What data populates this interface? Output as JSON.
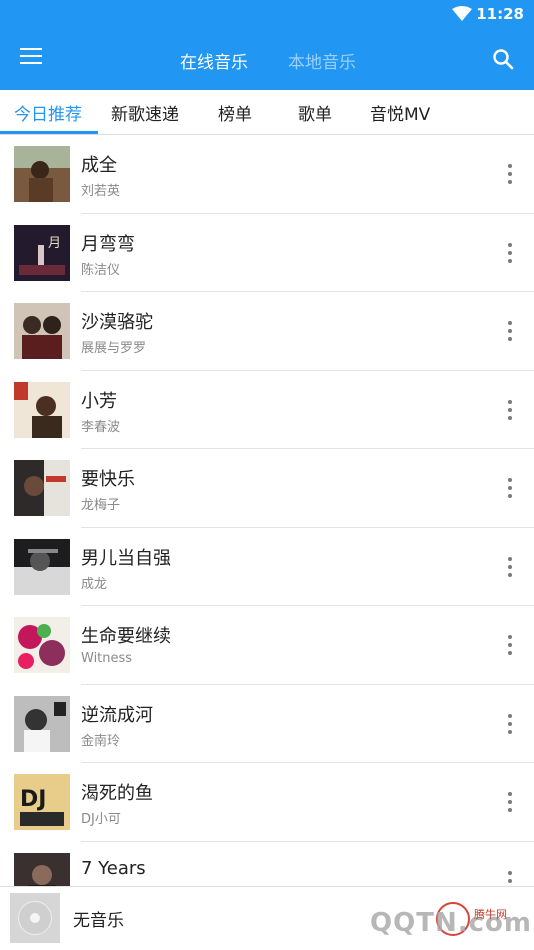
{
  "status_bar": {
    "time": "11:28"
  },
  "app_bar": {
    "tabs": [
      {
        "label": "在线音乐",
        "active": true
      },
      {
        "label": "本地音乐",
        "active": false
      }
    ]
  },
  "sub_tabs": [
    {
      "label": "今日推荐",
      "active": true
    },
    {
      "label": "新歌速递",
      "active": false
    },
    {
      "label": "榜单",
      "active": false
    },
    {
      "label": "歌单",
      "active": false
    },
    {
      "label": "音悦MV",
      "active": false
    }
  ],
  "songs": [
    {
      "title": "成全",
      "artist": "刘若英",
      "cover_color": "#7a5a3e"
    },
    {
      "title": "月弯弯",
      "artist": "陈洁仪",
      "cover_color": "#231a2e"
    },
    {
      "title": "沙漠骆驼",
      "artist": "展展与罗罗",
      "cover_color": "#cfc4b6"
    },
    {
      "title": "小芳",
      "artist": "李春波",
      "cover_color": "#5b3d2c"
    },
    {
      "title": "要快乐",
      "artist": "龙梅子",
      "cover_color": "#2e2a2a"
    },
    {
      "title": "男儿当自强",
      "artist": "成龙",
      "cover_color": "#1d1d1f"
    },
    {
      "title": "生命要继续",
      "artist": "Witness",
      "cover_color": "#8d2f5c"
    },
    {
      "title": "逆流成河",
      "artist": "金南玲",
      "cover_color": "#9a9a9a"
    },
    {
      "title": "渴死的鱼",
      "artist": "DJ小可",
      "cover_color": "#e8cc8a"
    },
    {
      "title": "7 Years",
      "artist": "",
      "cover_color": "#3a3030"
    }
  ],
  "player": {
    "now_playing": "无音乐"
  },
  "watermark": {
    "text": "QQTN.com",
    "sub": "腾牛网"
  },
  "colors": {
    "primary": "#2196f3",
    "text": "#222222",
    "secondary_text": "#8a8a8a"
  }
}
